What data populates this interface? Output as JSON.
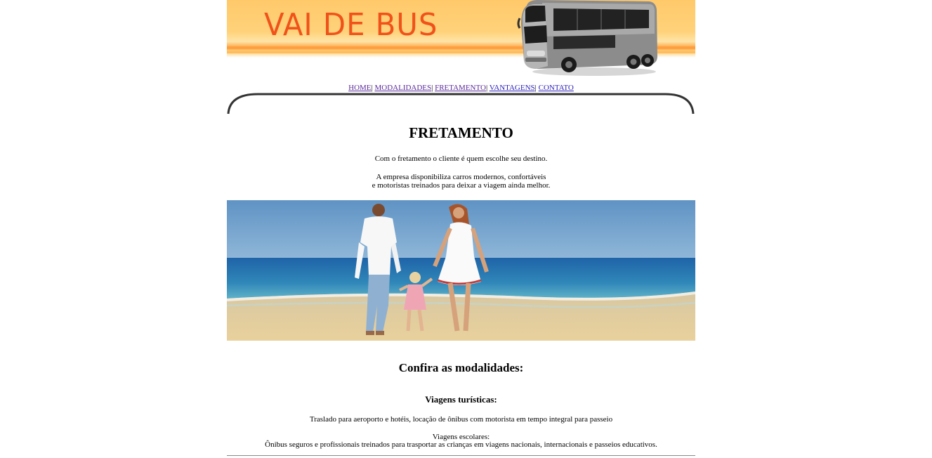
{
  "header": {
    "logo_text": "VAI DE BUS"
  },
  "nav": {
    "items": [
      {
        "label": "HOME"
      },
      {
        "label": "MODALIDADES"
      },
      {
        "label": "FRETAMENTO"
      },
      {
        "label": "VANTAGENS"
      },
      {
        "label": "CONTATO"
      }
    ],
    "separator": "|"
  },
  "main": {
    "title": "FRETAMENTO",
    "intro": "Com o fretamento o cliente é quem escolhe seu destino.",
    "desc_line1": "A empresa disponibiliza carros modernos, confortáveis",
    "desc_line2": "e motoristas treinados para deixar a viagem ainda melhor.",
    "section_title": "Confira as modalidades:",
    "sub_title": "Viagens turísticas:",
    "tourism_text": "Traslado para aeroporto e hotéis, locação de ônibus com motorista em tempo integral para passeio",
    "school_title": "Viagens escolares:",
    "school_text": "Ônibus seguros e profissionais treinados para trasportar as crianças em viagens nacionais, internacionais e passeios educativos."
  },
  "colors": {
    "banner": "#ffc96a",
    "logo": "#f0521a",
    "link": "#2a1fb8",
    "link_visited": "#5a2a9a"
  },
  "icons": {
    "bus": "double-decker-bus-image",
    "photo": "family-beach-photo"
  }
}
